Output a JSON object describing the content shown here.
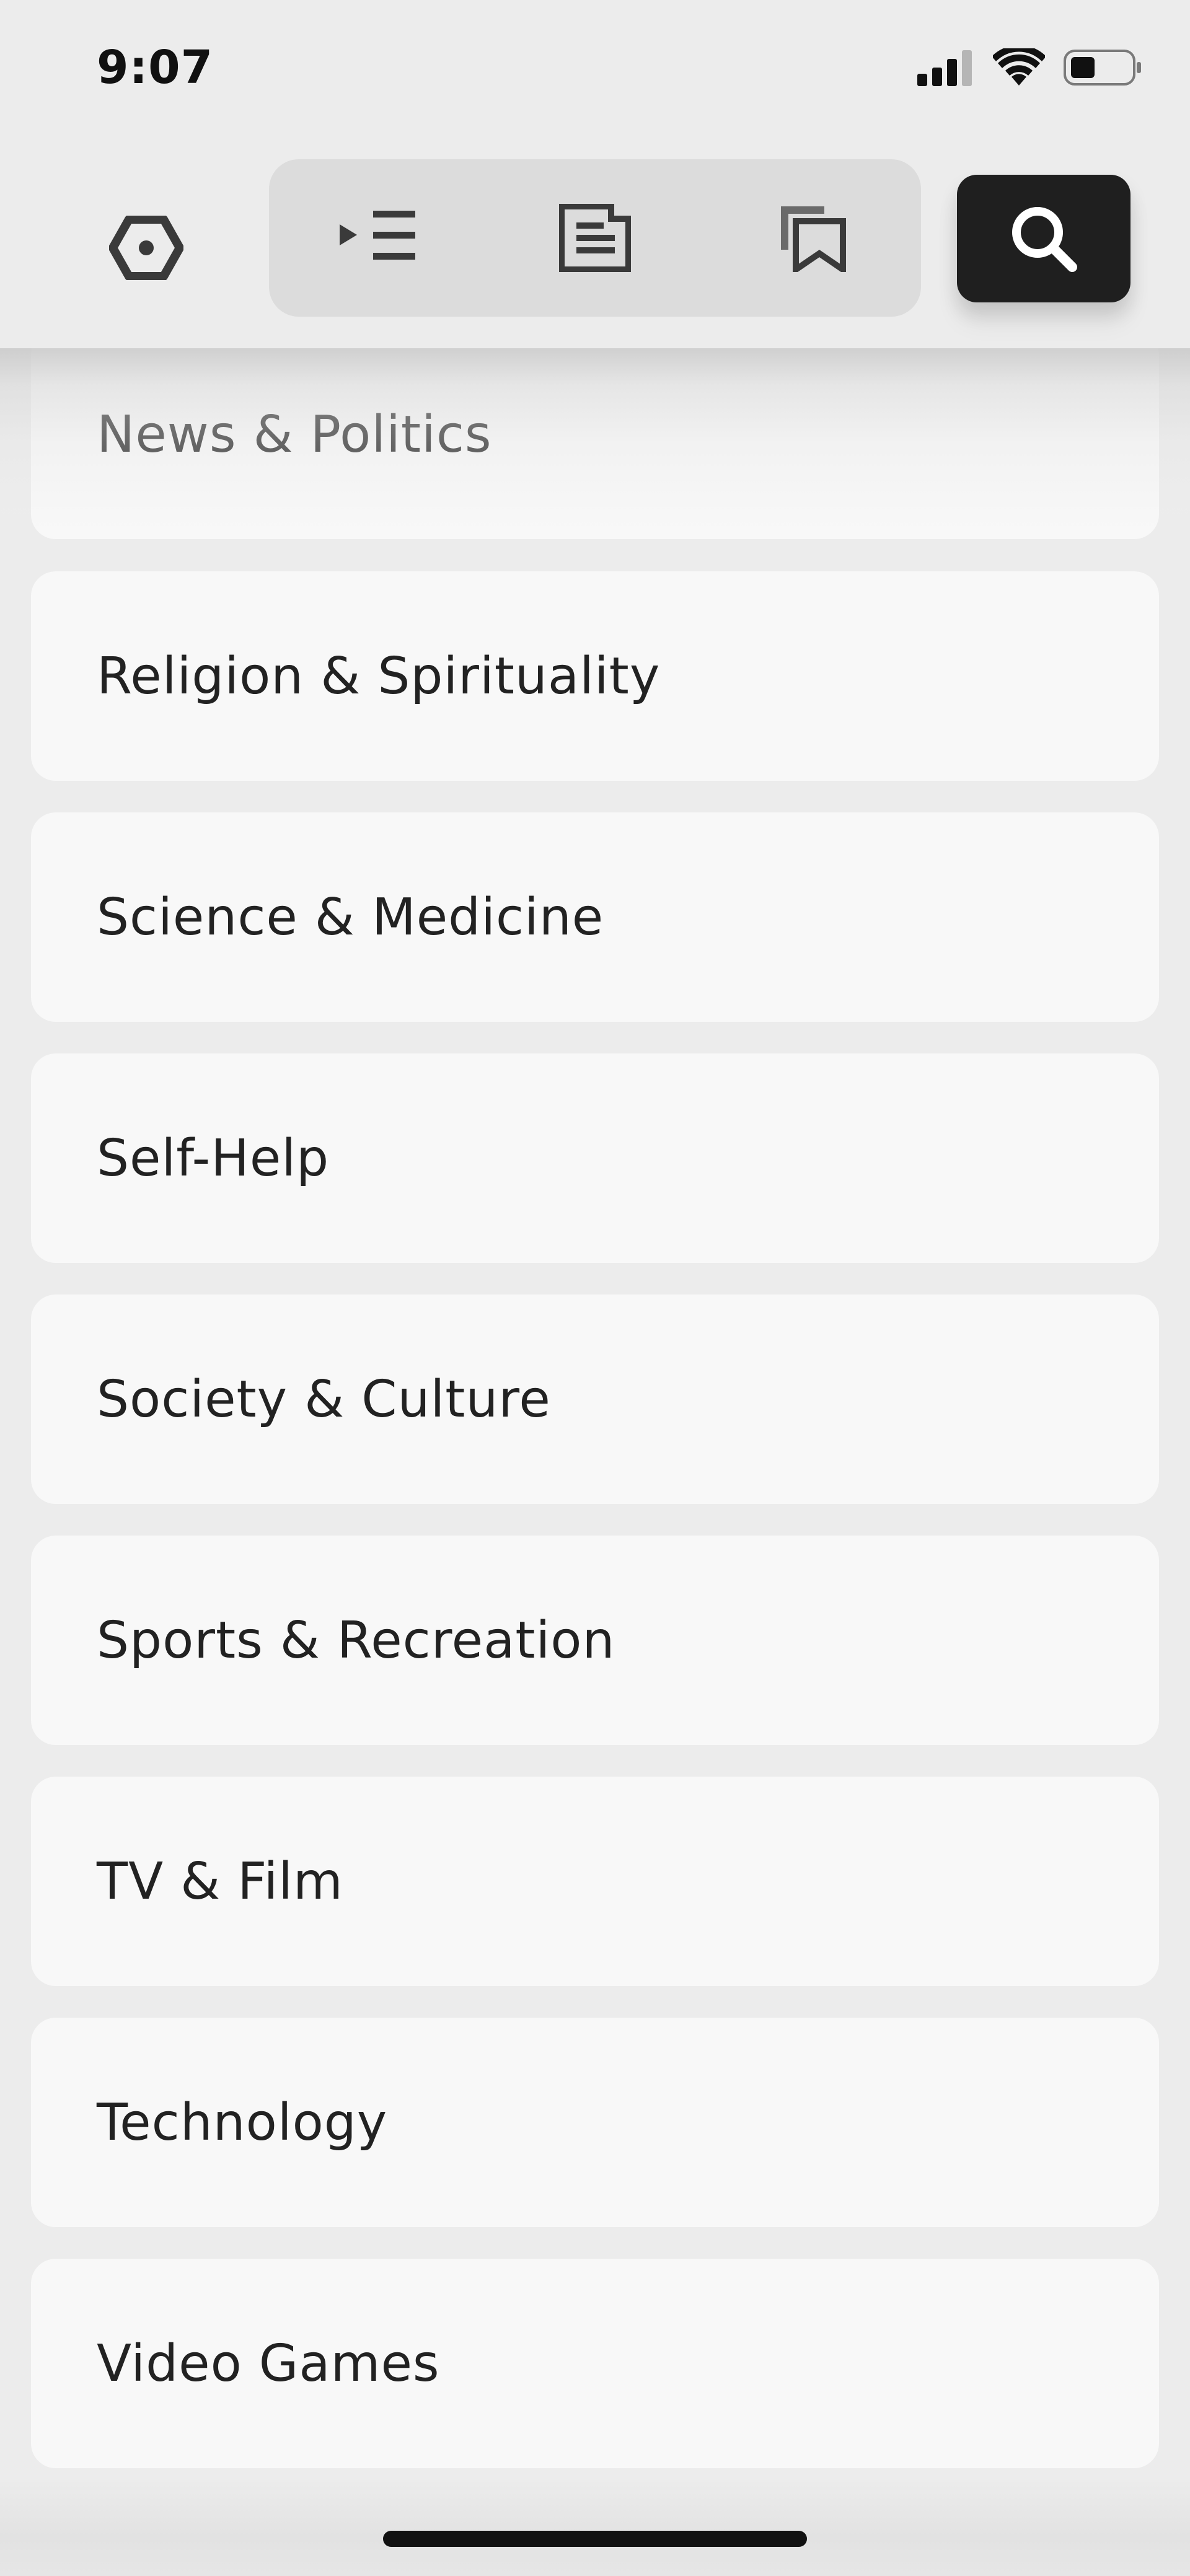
{
  "status_bar": {
    "time": "9:07"
  },
  "toolbar": {
    "logo_icon": "hexagon-icon",
    "tabs": [
      {
        "icon": "play-queue-icon",
        "active": false
      },
      {
        "icon": "document-list-icon",
        "active": false
      },
      {
        "icon": "bookmark-stack-icon",
        "active": false
      }
    ],
    "search_icon": "search-icon",
    "search_active": true
  },
  "categories": [
    {
      "label": "News & Politics"
    },
    {
      "label": "Religion & Spirituality"
    },
    {
      "label": "Science & Medicine"
    },
    {
      "label": "Self-Help"
    },
    {
      "label": "Society & Culture"
    },
    {
      "label": "Sports & Recreation"
    },
    {
      "label": "TV & Film"
    },
    {
      "label": "Technology"
    },
    {
      "label": "Video Games"
    }
  ],
  "colors": {
    "background": "#ececec",
    "card": "#f8f8f8",
    "segmented_bg": "#dcdcdc",
    "search_bg": "#1f1f1f",
    "text": "#222222",
    "icon": "#3a3a3a"
  }
}
